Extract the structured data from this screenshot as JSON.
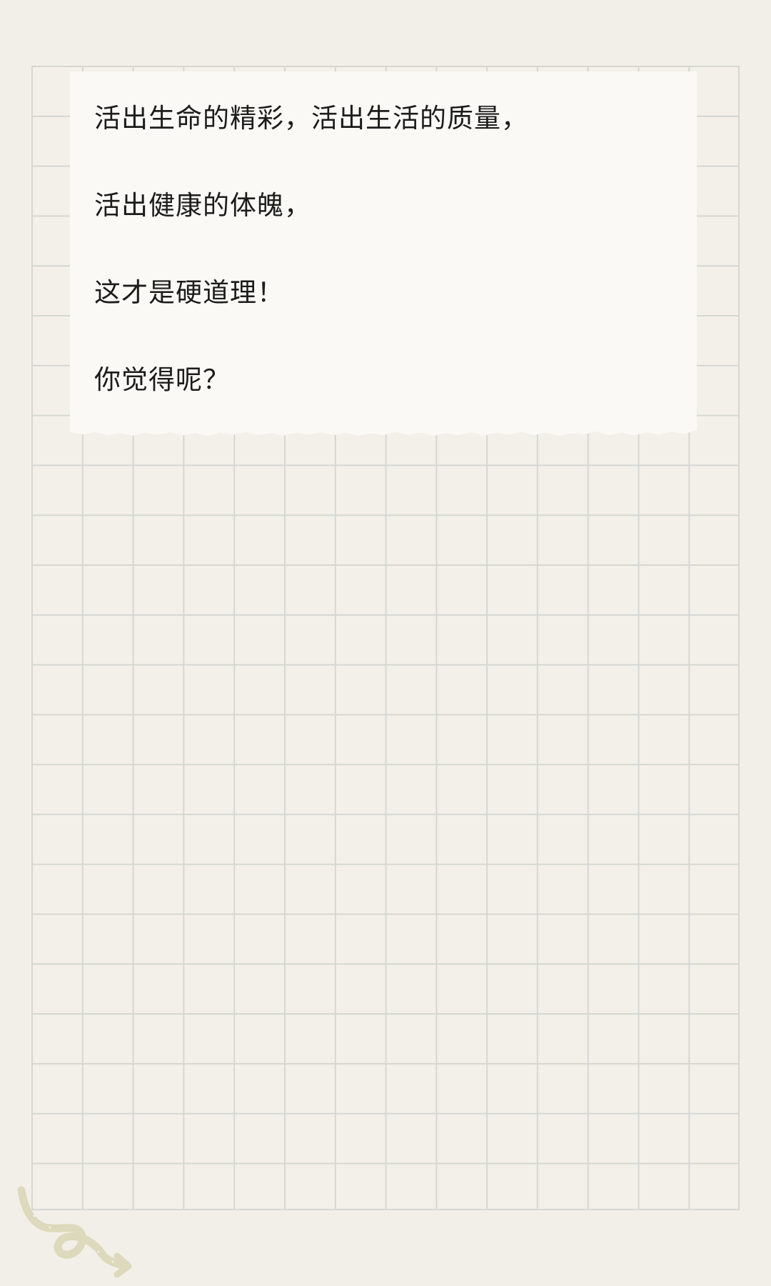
{
  "note": {
    "lines": [
      "活出生命的精彩，活出生活的质量，",
      "活出健康的体魄，",
      "这才是硬道理！",
      "你觉得呢？"
    ]
  },
  "colors": {
    "background": "#f2efe8",
    "grid_line": "#d5d7d3",
    "card": "#faf9f5",
    "text": "#1c1c1c",
    "doodle": "#dcd9bc"
  },
  "icons": {
    "decoration": "doodle-arrow-icon"
  }
}
